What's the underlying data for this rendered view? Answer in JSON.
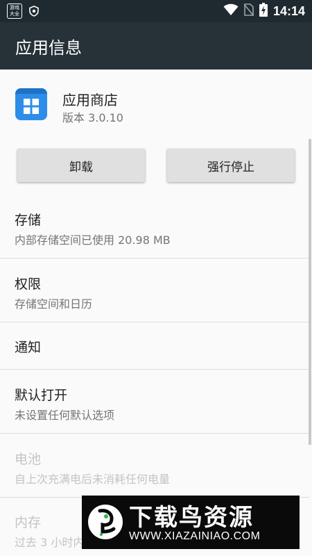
{
  "status_bar": {
    "game_icon_text": "游戏大全",
    "time": "14:14"
  },
  "app_bar": {
    "title": "应用信息"
  },
  "app": {
    "name": "应用商店",
    "version": "版本 3.0.10",
    "icon": "app-store-icon",
    "icon_color": "#2d8de8"
  },
  "buttons": {
    "uninstall": "卸载",
    "force_stop": "强行停止"
  },
  "settings": [
    {
      "title": "存储",
      "subtitle": "内部存储空间已使用 20.98 MB",
      "enabled": true
    },
    {
      "title": "权限",
      "subtitle": "存储空间和日历",
      "enabled": true
    },
    {
      "title": "通知",
      "subtitle": "",
      "enabled": true
    },
    {
      "title": "默认打开",
      "subtitle": "未设置任何默认选项",
      "enabled": true
    },
    {
      "title": "电池",
      "subtitle": "自上次充满电后未消耗任何电量",
      "enabled": false
    },
    {
      "title": "内存",
      "subtitle": "过去 3 小时内",
      "enabled": false
    }
  ],
  "watermark": {
    "title": "下载鸟资源",
    "url": "WWW.XIAZAINIAO.COM"
  },
  "colors": {
    "app_bar": "#263238",
    "status_bar": "#1f2a30",
    "background": "#fafafa"
  }
}
